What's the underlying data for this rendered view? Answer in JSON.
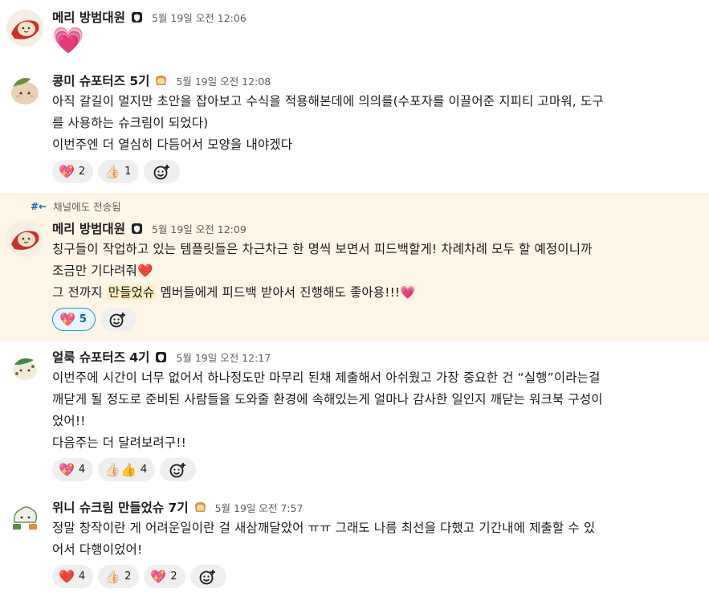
{
  "messages": [
    {
      "name": "메리 방범대원",
      "status_icon": "shield-badge-icon",
      "time": "5월 19일 오전 12:06",
      "big_emoji": "💗",
      "lines": [],
      "reactions": []
    },
    {
      "name": "콩미 슈포터즈 5기",
      "status_icon": "bread-icon",
      "time": "5월 19일 오전 12:08",
      "lines": [
        "아직 갈길이 멀지만 초안을 잡아보고 수식을 적용해본데에 의의를(수포자를 이끌어준 지피티 고마워, 도구",
        "를 사용하는 슈크림이 되었다)",
        "이번주엔 더 열심히 다듬어서 모양을 내야겠다"
      ],
      "reactions": [
        {
          "emoji": "💖",
          "count": "2"
        },
        {
          "emoji": "👍🏻",
          "count": "1"
        }
      ]
    },
    {
      "sent_note": "채널에도 전송됨",
      "name": "메리 방범대원",
      "status_icon": "shield-badge-icon",
      "time": "5월 19일 오전 12:09",
      "lines": [
        "칭구들이 작업하고 있는 템플릿들은 차근차근 한 명씩 보면서 피드백할게! 차례차례 모두 할 예정이니까",
        "조금만 기다려줘❤️"
      ],
      "line3_pre": "그 전까지 ",
      "line3_mention": "만들었슈",
      "line3_post": " 멤버들에게 피드백 받아서 진행해도 좋아용!!!💗",
      "reactions": [
        {
          "emoji": "💖",
          "count": "5"
        }
      ]
    },
    {
      "name": "얼룩 슈포터즈 4기",
      "status_icon": "shield-badge-icon",
      "time": "5월 19일 오전 12:17",
      "lines": [
        "이번주에 시간이 너무 없어서 하나정도만 마무리 된채 제출해서 아쉬웠고 가장 중요한 건 “실행”이라는걸",
        "깨닫게 될 정도로 준비된 사람들을 도와줄 환경에 속해있는게 얼마나 감사한 일인지 깨닫는 워크북 구성이",
        "었어!!",
        "다음주는 더 달려보려구!!"
      ],
      "reactions": [
        {
          "emoji": "💖",
          "count": "4"
        },
        {
          "emoji": "👍🏻👍",
          "count": "4"
        }
      ]
    },
    {
      "name": "위니 슈크림 만들었슈 7기",
      "status_icon": "bread-icon",
      "time": "5월 19일 오전 7:57",
      "lines": [
        "정말 창작이란 게 어려운일이란 걸 새삼깨달았어 ㅠㅠ 그래도 나름 최선을 다했고 기간내에 제출할 수 있",
        "어서 다행이었어!"
      ],
      "reactions": [
        {
          "emoji": "❤️",
          "count": "4"
        },
        {
          "emoji": "👍🏻",
          "count": "2"
        },
        {
          "emoji": "💖",
          "count": "2"
        }
      ]
    }
  ],
  "colors": {
    "highlight_bg": "#fdf5e6",
    "mention_bg": "#fdeebb",
    "link_blue": "#1264a3",
    "timestamp_gray": "#616061",
    "reaction_bg": "#efefef"
  }
}
